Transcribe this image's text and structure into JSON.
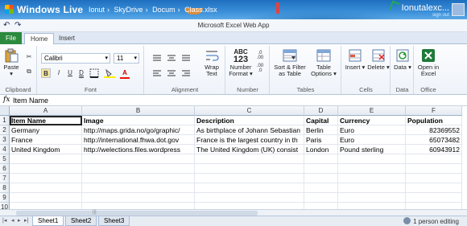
{
  "titlebar": {
    "brand": "Windows Live",
    "breadcrumbs": [
      "Ionut",
      "SkyDrive",
      "Docum",
      "Class.xlsx"
    ],
    "user": "Ionutalexc...",
    "user_sub": "sign out"
  },
  "appbar": {
    "title": "Microsoft Excel Web App",
    "undo": "↶",
    "redo": "↷"
  },
  "tabs": {
    "file": "File",
    "home": "Home",
    "insert": "Insert"
  },
  "ribbon": {
    "clipboard": {
      "label": "Clipboard",
      "paste": "Paste",
      "cut_icon": "✂",
      "copy_icon": "⧉"
    },
    "font": {
      "label": "Font",
      "family": "Calibri",
      "size": "11",
      "bold": "B",
      "italic": "I",
      "underline": "U",
      "double_underline": "D"
    },
    "alignment": {
      "label": "Alignment",
      "wrap": "Wrap\nText"
    },
    "number": {
      "label": "Number",
      "format_line1": "Number",
      "format_line2": "Format",
      "abc": "ABC",
      "digits": "123",
      "dec_inc": ".0\n.00",
      "dec_dec": ".00\n.0"
    },
    "tables": {
      "label": "Tables",
      "sort_line1": "Sort & Filter",
      "sort_line2": "as Table",
      "table_line1": "Table",
      "table_line2": "Options"
    },
    "cells": {
      "label": "Cells",
      "insert": "Insert",
      "delete": "Delete"
    },
    "data": {
      "label": "Data",
      "data": "Data"
    },
    "office": {
      "label": "Office",
      "open_line1": "Open in",
      "open_line2": "Excel"
    }
  },
  "formula_bar": {
    "fx": "fx",
    "value": "Item Name"
  },
  "grid": {
    "columns": [
      "A",
      "B",
      "C",
      "D",
      "E",
      "F"
    ],
    "rows": [
      "1",
      "2",
      "3",
      "4",
      "5",
      "6",
      "7",
      "8",
      "9",
      "10"
    ],
    "headers": [
      "Item Name",
      "Image",
      "Description",
      "Capital",
      "Currency",
      "Population"
    ],
    "data": [
      [
        "Germany",
        "http://maps.grida.no/go/graphic/",
        "As birthplace of Johann Sebastian",
        "Berlin",
        "Euro",
        "82369552"
      ],
      [
        "France",
        "http://international.fhwa.dot.gov",
        "France is the largest country in th",
        "Paris",
        "Euro",
        "65073482"
      ],
      [
        "United Kingdom",
        "http://welections.files.wordpress",
        "The United Kingdom (UK) consist",
        "London",
        "Pound sterling",
        "60943912"
      ]
    ]
  },
  "sheets": {
    "tabs": [
      "Sheet1",
      "Sheet2",
      "Sheet3"
    ],
    "active": "Sheet1",
    "status": "1 person editing",
    "nav": [
      "|◂",
      "◂",
      "▸",
      "▸|"
    ]
  },
  "colors": {
    "file_tab": "#2b8a3e",
    "title_bar": "#1f6fc0"
  }
}
